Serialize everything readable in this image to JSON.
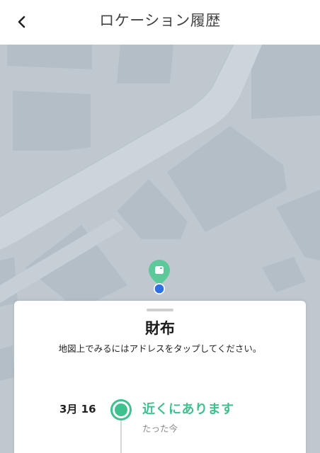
{
  "header": {
    "title": "ロケーション履歴",
    "back_icon": "chevron-left-icon"
  },
  "map": {
    "background_color": "#bfc8cf",
    "road_color": "#ccd5db",
    "building_color": "#b3bec6",
    "pin_color": "#5cc99b",
    "location_dot_color": "#2f6fe4"
  },
  "sheet": {
    "item_name": "財布",
    "hint": "地図上でみるにはアドレスをタップしてください。",
    "entries": [
      {
        "date": "3月 16",
        "status": "近くにあります",
        "time_ago": "たった今"
      }
    ],
    "accent_color": "#3ec18e"
  }
}
